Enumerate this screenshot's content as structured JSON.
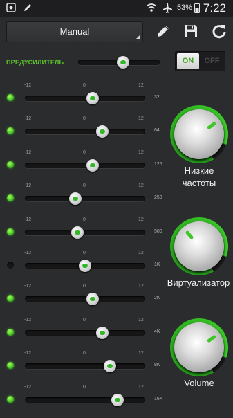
{
  "status_bar": {
    "battery": "53%",
    "time": "7:22"
  },
  "toolbar": {
    "preset": "Manual",
    "icons": [
      "edit-icon",
      "save-icon",
      "reset-icon"
    ]
  },
  "preamp": {
    "label": "ПРЕДУСИЛИТЕЛЬ",
    "level": 0.55,
    "switch_on": "ON",
    "switch_off": "OFF"
  },
  "scale": {
    "min": "-12",
    "mid": "0",
    "max": "12"
  },
  "bands": [
    {
      "freq": "32",
      "active": true,
      "gain": 1.5
    },
    {
      "freq": "64",
      "active": true,
      "gain": 3.5
    },
    {
      "freq": "125",
      "active": true,
      "gain": 1.5
    },
    {
      "freq": "250",
      "active": true,
      "gain": -2.0
    },
    {
      "freq": "500",
      "active": true,
      "gain": -1.5
    },
    {
      "freq": "1K",
      "active": false,
      "gain": 0.0
    },
    {
      "freq": "2K",
      "active": true,
      "gain": 1.5
    },
    {
      "freq": "4K",
      "active": true,
      "gain": 3.5
    },
    {
      "freq": "8K",
      "active": true,
      "gain": 5.0
    },
    {
      "freq": "16K",
      "active": true,
      "gain": 6.5
    }
  ],
  "dials": [
    {
      "label": "Низкие частоты",
      "level": 0.7
    },
    {
      "label": "Виртуализатор",
      "level": 0.35
    },
    {
      "label": "Volume",
      "level": 0.7
    }
  ],
  "colors": {
    "accent": "#3fc728",
    "background": "#2b2c2e"
  }
}
